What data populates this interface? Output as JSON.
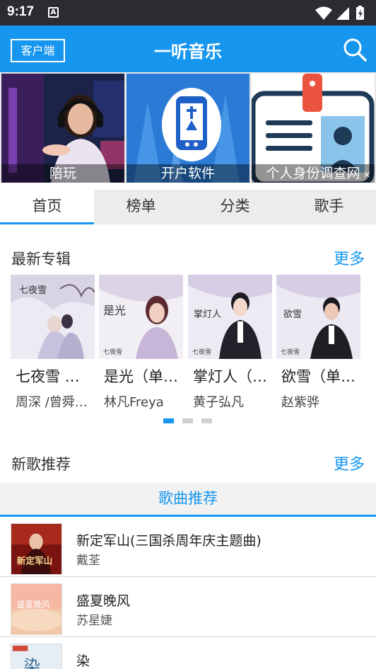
{
  "status_bar": {
    "time": "9:17",
    "notif_glyph": "A"
  },
  "header": {
    "client_label": "客户端",
    "title": "一听音乐",
    "search_icon": "search-icon"
  },
  "banner": {
    "items": [
      {
        "caption": "陪玩"
      },
      {
        "caption": "开户软件"
      },
      {
        "caption": "个人身份调查网"
      }
    ]
  },
  "tabs": [
    {
      "label": "首页"
    },
    {
      "label": "榜单"
    },
    {
      "label": "分类"
    },
    {
      "label": "歌手"
    }
  ],
  "latest_albums": {
    "title": "最新专辑",
    "more": "更多",
    "items": [
      {
        "name": "七夜雪 …",
        "artist": "周深 /曾舜…"
      },
      {
        "name": "是光（单…",
        "artist": "林凡Freya"
      },
      {
        "name": "掌灯人（…",
        "artist": "黄子弘凡"
      },
      {
        "name": "欲雪（单…",
        "artist": "赵紫骅"
      }
    ]
  },
  "new_songs": {
    "title": "新歌推荐",
    "more": "更多",
    "tab_label": "歌曲推荐",
    "items": [
      {
        "title": "新定军山(三国杀周年庆主题曲)",
        "artist": "戴荃"
      },
      {
        "title": "盛夏晚风",
        "artist": "苏星婕"
      },
      {
        "title": "染",
        "artist": ""
      }
    ]
  },
  "colors": {
    "accent": "#1696ee",
    "status_bar": "#2a2c31"
  }
}
